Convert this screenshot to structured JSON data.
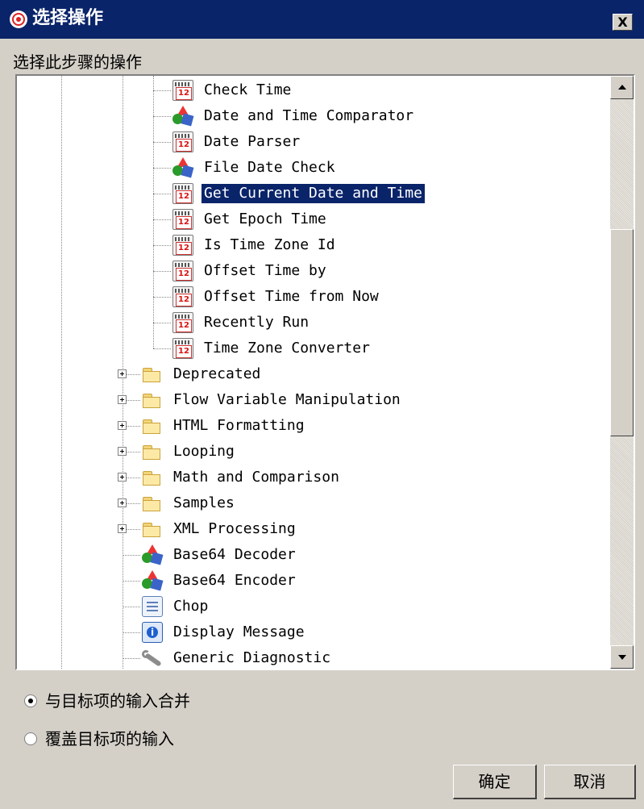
{
  "window": {
    "title": "选择操作",
    "close_label": "X"
  },
  "subtitle": "选择此步骤的操作",
  "tree": {
    "items": [
      {
        "label": "Check Time",
        "icon": "calendar-icon",
        "calendar_text": "12",
        "level": 3
      },
      {
        "label": "Date and Time Comparator",
        "icon": "shapes-icon",
        "level": 3
      },
      {
        "label": "Date Parser",
        "icon": "calendar-icon",
        "calendar_text": "12",
        "level": 3
      },
      {
        "label": "File Date Check",
        "icon": "shapes-icon",
        "level": 3
      },
      {
        "label": "Get Current Date and Time",
        "icon": "calendar-icon",
        "calendar_text": "12",
        "level": 3,
        "selected": true
      },
      {
        "label": "Get Epoch Time",
        "icon": "calendar-icon",
        "calendar_text": "12",
        "level": 3
      },
      {
        "label": "Is Time Zone Id",
        "icon": "calendar-icon",
        "calendar_text": "12",
        "level": 3
      },
      {
        "label": "Offset Time by",
        "icon": "calendar-icon",
        "calendar_text": "12",
        "level": 3
      },
      {
        "label": "Offset Time from Now",
        "icon": "calendar-icon",
        "calendar_text": "12",
        "level": 3
      },
      {
        "label": "Recently Run",
        "icon": "calendar-icon",
        "calendar_text": "12",
        "level": 3
      },
      {
        "label": "Time Zone Converter",
        "icon": "calendar-icon",
        "calendar_text": "12",
        "level": 3
      },
      {
        "label": "Deprecated",
        "icon": "folder-icon",
        "level": 2,
        "expandable": true
      },
      {
        "label": "Flow Variable Manipulation",
        "icon": "folder-icon",
        "level": 2,
        "expandable": true
      },
      {
        "label": "HTML Formatting",
        "icon": "folder-icon",
        "level": 2,
        "expandable": true
      },
      {
        "label": "Looping",
        "icon": "folder-icon",
        "level": 2,
        "expandable": true
      },
      {
        "label": "Math and Comparison",
        "icon": "folder-icon",
        "level": 2,
        "expandable": true
      },
      {
        "label": "Samples",
        "icon": "folder-icon",
        "level": 2,
        "expandable": true
      },
      {
        "label": "XML Processing",
        "icon": "folder-icon",
        "level": 2,
        "expandable": true
      },
      {
        "label": "Base64 Decoder",
        "icon": "shapes-icon",
        "level": 2
      },
      {
        "label": "Base64 Encoder",
        "icon": "shapes-icon",
        "level": 2
      },
      {
        "label": "Chop",
        "icon": "document-icon",
        "level": 2
      },
      {
        "label": "Display Message",
        "icon": "info-icon",
        "level": 2
      },
      {
        "label": "Generic Diagnostic",
        "icon": "wrench-icon",
        "level": 2
      }
    ]
  },
  "options": [
    {
      "label": "与目标项的输入合并",
      "checked": true
    },
    {
      "label": "覆盖目标项的输入",
      "checked": false
    }
  ],
  "buttons": {
    "ok": "确定",
    "cancel": "取消"
  }
}
